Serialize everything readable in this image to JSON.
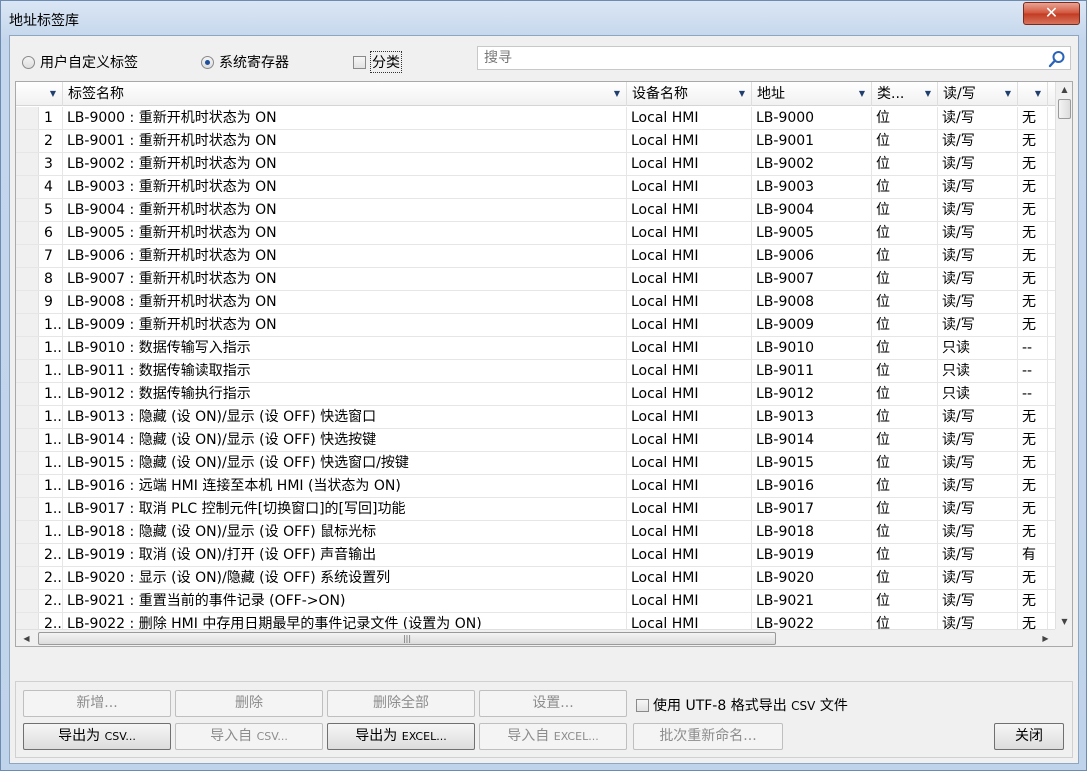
{
  "window": {
    "title": "地址标签库",
    "close_glyph": "✕"
  },
  "options": {
    "user_defined_label": "用户自定义标签",
    "system_register_label": "系统寄存器",
    "system_register_selected": true,
    "category_label": "分类",
    "search_placeholder": "搜寻"
  },
  "table": {
    "columns": [
      "标签名称",
      "设备名称",
      "地址",
      "类...",
      "读/写",
      ""
    ],
    "rows": [
      {
        "idx": "1",
        "name": "LB-9000 : 重新开机时状态为 ON",
        "device": "Local HMI",
        "address": "LB-9000",
        "type": "位",
        "rw": "读/写",
        "extra": "无"
      },
      {
        "idx": "2",
        "name": "LB-9001 : 重新开机时状态为 ON",
        "device": "Local HMI",
        "address": "LB-9001",
        "type": "位",
        "rw": "读/写",
        "extra": "无"
      },
      {
        "idx": "3",
        "name": "LB-9002 : 重新开机时状态为 ON",
        "device": "Local HMI",
        "address": "LB-9002",
        "type": "位",
        "rw": "读/写",
        "extra": "无"
      },
      {
        "idx": "4",
        "name": "LB-9003 : 重新开机时状态为 ON",
        "device": "Local HMI",
        "address": "LB-9003",
        "type": "位",
        "rw": "读/写",
        "extra": "无"
      },
      {
        "idx": "5",
        "name": "LB-9004 : 重新开机时状态为 ON",
        "device": "Local HMI",
        "address": "LB-9004",
        "type": "位",
        "rw": "读/写",
        "extra": "无"
      },
      {
        "idx": "6",
        "name": "LB-9005 : 重新开机时状态为 ON",
        "device": "Local HMI",
        "address": "LB-9005",
        "type": "位",
        "rw": "读/写",
        "extra": "无"
      },
      {
        "idx": "7",
        "name": "LB-9006 : 重新开机时状态为 ON",
        "device": "Local HMI",
        "address": "LB-9006",
        "type": "位",
        "rw": "读/写",
        "extra": "无"
      },
      {
        "idx": "8",
        "name": "LB-9007 : 重新开机时状态为 ON",
        "device": "Local HMI",
        "address": "LB-9007",
        "type": "位",
        "rw": "读/写",
        "extra": "无"
      },
      {
        "idx": "9",
        "name": "LB-9008 : 重新开机时状态为 ON",
        "device": "Local HMI",
        "address": "LB-9008",
        "type": "位",
        "rw": "读/写",
        "extra": "无"
      },
      {
        "idx": "1..",
        "name": "LB-9009 : 重新开机时状态为 ON",
        "device": "Local HMI",
        "address": "LB-9009",
        "type": "位",
        "rw": "读/写",
        "extra": "无"
      },
      {
        "idx": "1..",
        "name": "LB-9010 : 数据传输写入指示",
        "device": "Local HMI",
        "address": "LB-9010",
        "type": "位",
        "rw": "只读",
        "extra": "--"
      },
      {
        "idx": "1..",
        "name": "LB-9011 : 数据传输读取指示",
        "device": "Local HMI",
        "address": "LB-9011",
        "type": "位",
        "rw": "只读",
        "extra": "--"
      },
      {
        "idx": "1..",
        "name": "LB-9012 : 数据传输执行指示",
        "device": "Local HMI",
        "address": "LB-9012",
        "type": "位",
        "rw": "只读",
        "extra": "--"
      },
      {
        "idx": "1..",
        "name": "LB-9013 : 隐藏 (设 ON)/显示 (设 OFF) 快选窗口",
        "device": "Local HMI",
        "address": "LB-9013",
        "type": "位",
        "rw": "读/写",
        "extra": "无"
      },
      {
        "idx": "1..",
        "name": "LB-9014 : 隐藏 (设 ON)/显示 (设 OFF) 快选按键",
        "device": "Local HMI",
        "address": "LB-9014",
        "type": "位",
        "rw": "读/写",
        "extra": "无"
      },
      {
        "idx": "1..",
        "name": "LB-9015 : 隐藏 (设 ON)/显示 (设 OFF) 快选窗口/按键",
        "device": "Local HMI",
        "address": "LB-9015",
        "type": "位",
        "rw": "读/写",
        "extra": "无"
      },
      {
        "idx": "1..",
        "name": "LB-9016 : 远端 HMI 连接至本机 HMI (当状态为 ON)",
        "device": "Local HMI",
        "address": "LB-9016",
        "type": "位",
        "rw": "读/写",
        "extra": "无"
      },
      {
        "idx": "1..",
        "name": "LB-9017 : 取消 PLC 控制元件[切换窗口]的[写回]功能",
        "device": "Local HMI",
        "address": "LB-9017",
        "type": "位",
        "rw": "读/写",
        "extra": "无"
      },
      {
        "idx": "1..",
        "name": "LB-9018 : 隐藏 (设 ON)/显示 (设 OFF) 鼠标光标",
        "device": "Local HMI",
        "address": "LB-9018",
        "type": "位",
        "rw": "读/写",
        "extra": "无"
      },
      {
        "idx": "2..",
        "name": "LB-9019 : 取消 (设 ON)/打开 (设 OFF) 声音输出",
        "device": "Local HMI",
        "address": "LB-9019",
        "type": "位",
        "rw": "读/写",
        "extra": "有"
      },
      {
        "idx": "2..",
        "name": "LB-9020 : 显示 (设 ON)/隐藏 (设 OFF) 系统设置列",
        "device": "Local HMI",
        "address": "LB-9020",
        "type": "位",
        "rw": "读/写",
        "extra": "无"
      },
      {
        "idx": "2..",
        "name": "LB-9021 : 重置当前的事件记录 (OFF->ON)",
        "device": "Local HMI",
        "address": "LB-9021",
        "type": "位",
        "rw": "读/写",
        "extra": "无"
      },
      {
        "idx": "2..",
        "name": "LB-9022 : 删除 HMI 中存用日期最早的事件记录文件 (设置为 ON)",
        "device": "Local HMI",
        "address": "LB-9022",
        "type": "位",
        "rw": "读/写",
        "extra": "无"
      }
    ]
  },
  "buttons": {
    "add": "新增...",
    "delete": "删除",
    "delete_all": "删除全部",
    "settings": "设置...",
    "utf8_label_a": "使用 UTF-8 格式导出",
    "utf8_label_csv": "CSV",
    "utf8_label_b": "文件",
    "export_csv_a": "导出为",
    "export_csv_b": "CSV...",
    "import_csv_a": "导入自",
    "import_csv_b": "CSV...",
    "export_excel_a": "导出为",
    "export_excel_b": "EXCEL...",
    "import_excel_a": "导入自",
    "import_excel_b": "EXCEL...",
    "batch_rename": "批次重新命名...",
    "close": "关闭"
  }
}
